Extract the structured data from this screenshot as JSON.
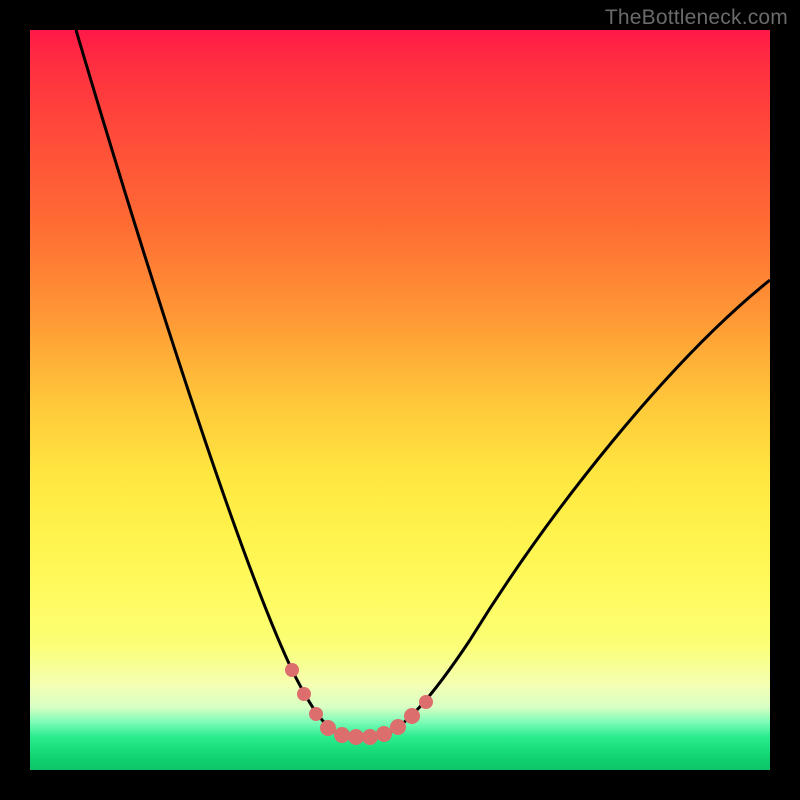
{
  "watermark": {
    "text": "TheBottleneck.com"
  },
  "colors": {
    "frame": "#000000",
    "curve_stroke": "#000000",
    "marker_fill": "#e07070",
    "gradient_top": "#ff1848",
    "gradient_bottom": "#0cc468"
  },
  "chart_data": {
    "type": "line",
    "title": "",
    "xlabel": "",
    "ylabel": "",
    "xlim": [
      0,
      100
    ],
    "ylim": [
      0,
      100
    ],
    "x": [
      0,
      4,
      8,
      12,
      16,
      20,
      24,
      28,
      32,
      34,
      36,
      38,
      40,
      42,
      44,
      46,
      48,
      52,
      56,
      60,
      64,
      70,
      76,
      82,
      88,
      94,
      100
    ],
    "series": [
      {
        "name": "bottleneck-curve",
        "values": [
          100,
          88,
          76,
          65,
          54,
          44,
          34,
          25,
          16,
          12,
          8,
          5,
          3,
          2,
          2,
          2,
          3,
          6,
          10,
          14,
          19,
          26,
          34,
          42,
          50,
          58,
          66
        ]
      }
    ],
    "markers": {
      "x": [
        34,
        36,
        38,
        40,
        42,
        44,
        46,
        48
      ],
      "y": [
        12,
        8,
        5,
        3,
        2,
        2,
        2,
        3
      ]
    }
  }
}
